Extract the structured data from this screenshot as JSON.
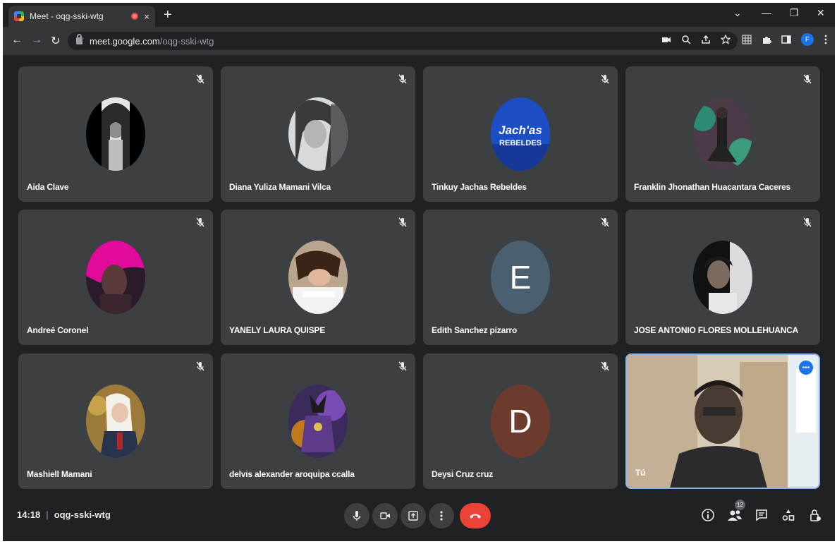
{
  "browser": {
    "tab_title": "Meet - oqg-sski-wtg",
    "tab_close": "×",
    "new_tab": "+",
    "url_host": "meet.google.com",
    "url_path": "/oqg-sski-wtg",
    "profile_initial": "F"
  },
  "participants": [
    {
      "name": "Aida Clave"
    },
    {
      "name": "Diana Yuliza Mamani Vilca"
    },
    {
      "name": "Tinkuy Jachas Rebeldes",
      "logo_text": [
        "Jach'as",
        "REBELDES"
      ]
    },
    {
      "name": "Franklin Jhonathan Huacantara Caceres"
    },
    {
      "name": "Andreé Coronel"
    },
    {
      "name": "YANELY LAURA QUISPE"
    },
    {
      "name": "Edith Sanchez pizarro",
      "initial": "E",
      "color": "#4a6070"
    },
    {
      "name": "JOSE ANTONIO FLORES MOLLEHUANCA"
    },
    {
      "name": "Mashiell Mamani"
    },
    {
      "name": "delvis alexander aroquipa ccalla"
    },
    {
      "name": "Deysi Cruz cruz",
      "initial": "D",
      "color": "#6d3b2e"
    },
    {
      "name": "Tú"
    }
  ],
  "bottom": {
    "time": "14:18",
    "separator": "|",
    "meeting_code": "oqg-sski-wtg",
    "people_count": "12"
  }
}
